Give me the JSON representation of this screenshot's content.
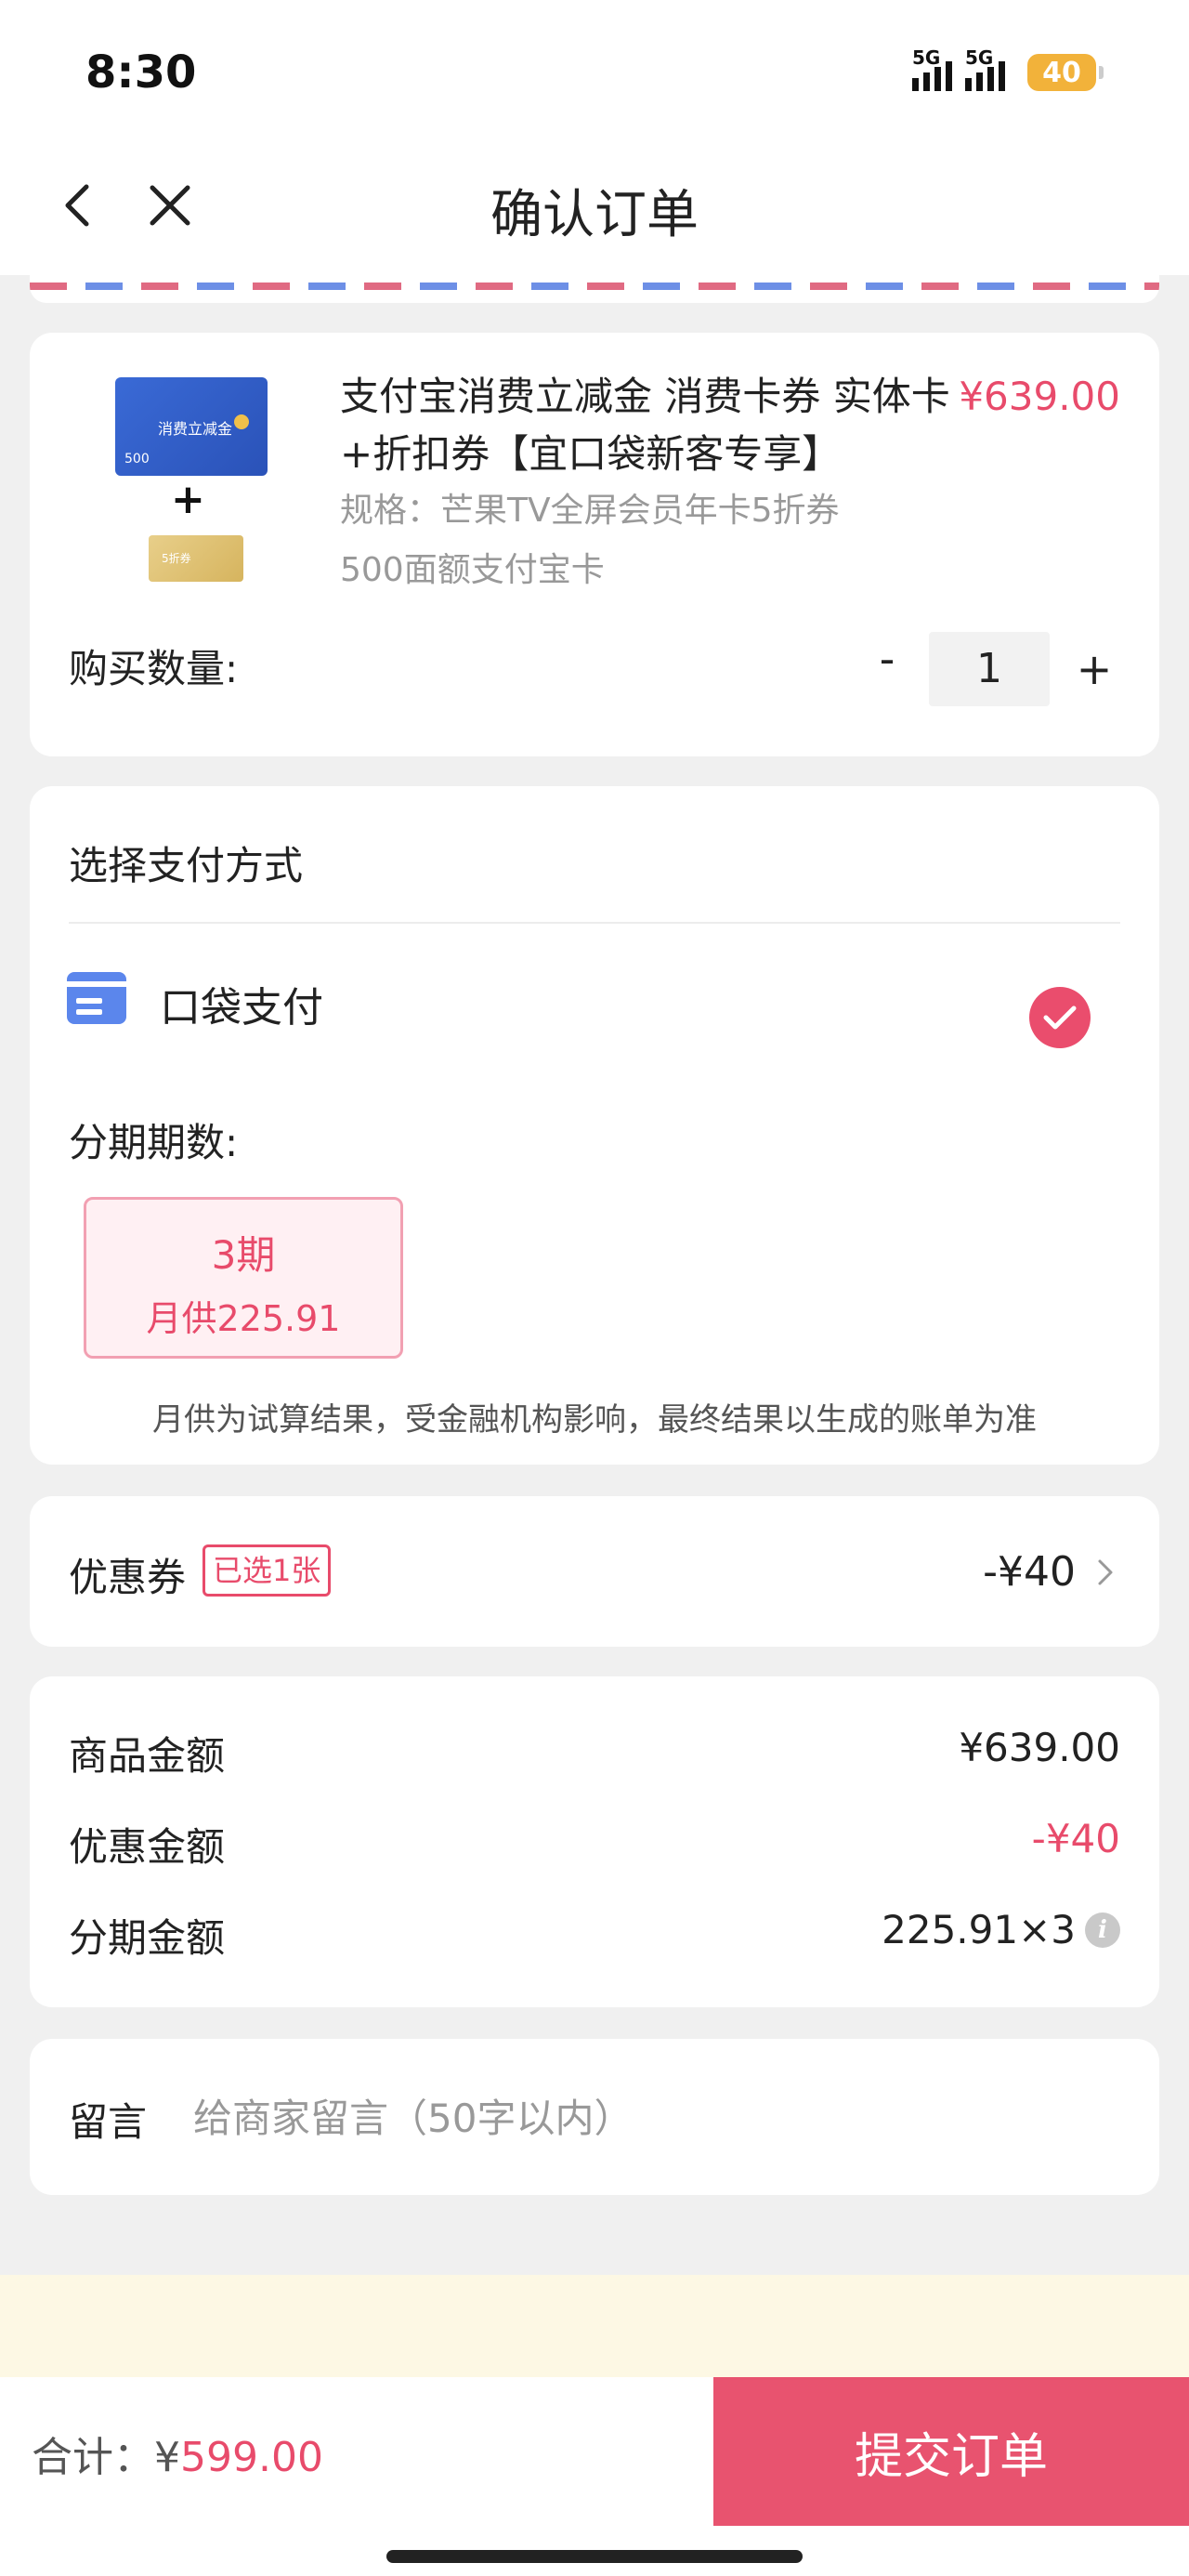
{
  "status_bar": {
    "time": "8:30",
    "network1": "5G",
    "network2": "5G",
    "battery": "40"
  },
  "nav": {
    "title": "确认订单",
    "back_icon": "chevron-left-icon",
    "close_icon": "close-icon"
  },
  "product": {
    "title": "支付宝消费立减金 消费卡券 实体卡+折扣券【宜口袋新客专享】",
    "price": "¥639.00",
    "spec_line1": "规格：芒果TV全屏会员年卡5折券",
    "spec_line2": "500面额支付宝卡",
    "image_card_caption": "消费立减金",
    "image_card_amount": "500",
    "image_coupon_caption": "5折券",
    "plus_sign": "+",
    "quantity_label": "购买数量:",
    "quantity": "1",
    "minus_label": "-",
    "plus_label": "+"
  },
  "payment": {
    "heading": "选择支付方式",
    "method": "口袋支付",
    "installment_label": "分期期数:",
    "installment_option": {
      "period": "3期",
      "monthly": "月供225.91"
    },
    "note": "月供为试算结果，受金融机构影响，最终结果以生成的账单为准"
  },
  "coupon": {
    "label": "优惠券",
    "badge": "已选1张",
    "value": "-¥40"
  },
  "summary": {
    "rows": [
      {
        "label": "商品金额",
        "value": "¥639.00"
      },
      {
        "label": "优惠金额",
        "value": "-¥40"
      },
      {
        "label": "分期金额",
        "value": "225.91×3"
      }
    ]
  },
  "message": {
    "label": "留言",
    "placeholder": "给商家留言（50字以内）"
  },
  "footer": {
    "total_label": "合计：¥",
    "total_value": "599.00",
    "submit": "提交订单"
  },
  "colors": {
    "accent": "#e84b6b",
    "pay_blue": "#5b86ec",
    "notice_bg": "#fdf8e4"
  }
}
